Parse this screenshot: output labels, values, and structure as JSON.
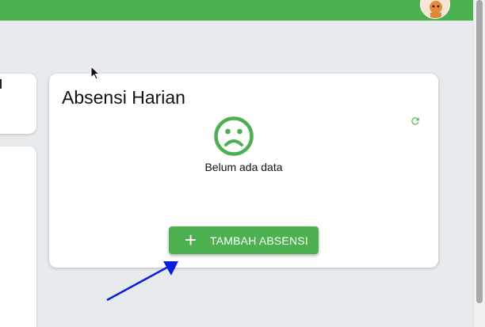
{
  "header": {
    "avatar_icon": "user-avatar-icon",
    "color": "#4caf50"
  },
  "card": {
    "title": "Absensi Harian",
    "refresh_icon": "refresh-icon",
    "empty_icon": "sad-face-icon",
    "empty_text": "Belum ada data",
    "add_button_icon": "plus-icon",
    "add_button_label": "TAMBAH ABSENSI",
    "accent": "#4caf50"
  },
  "annotation": {
    "arrow_icon": "arrow-annotation",
    "arrow_color": "#0a1ee0"
  }
}
